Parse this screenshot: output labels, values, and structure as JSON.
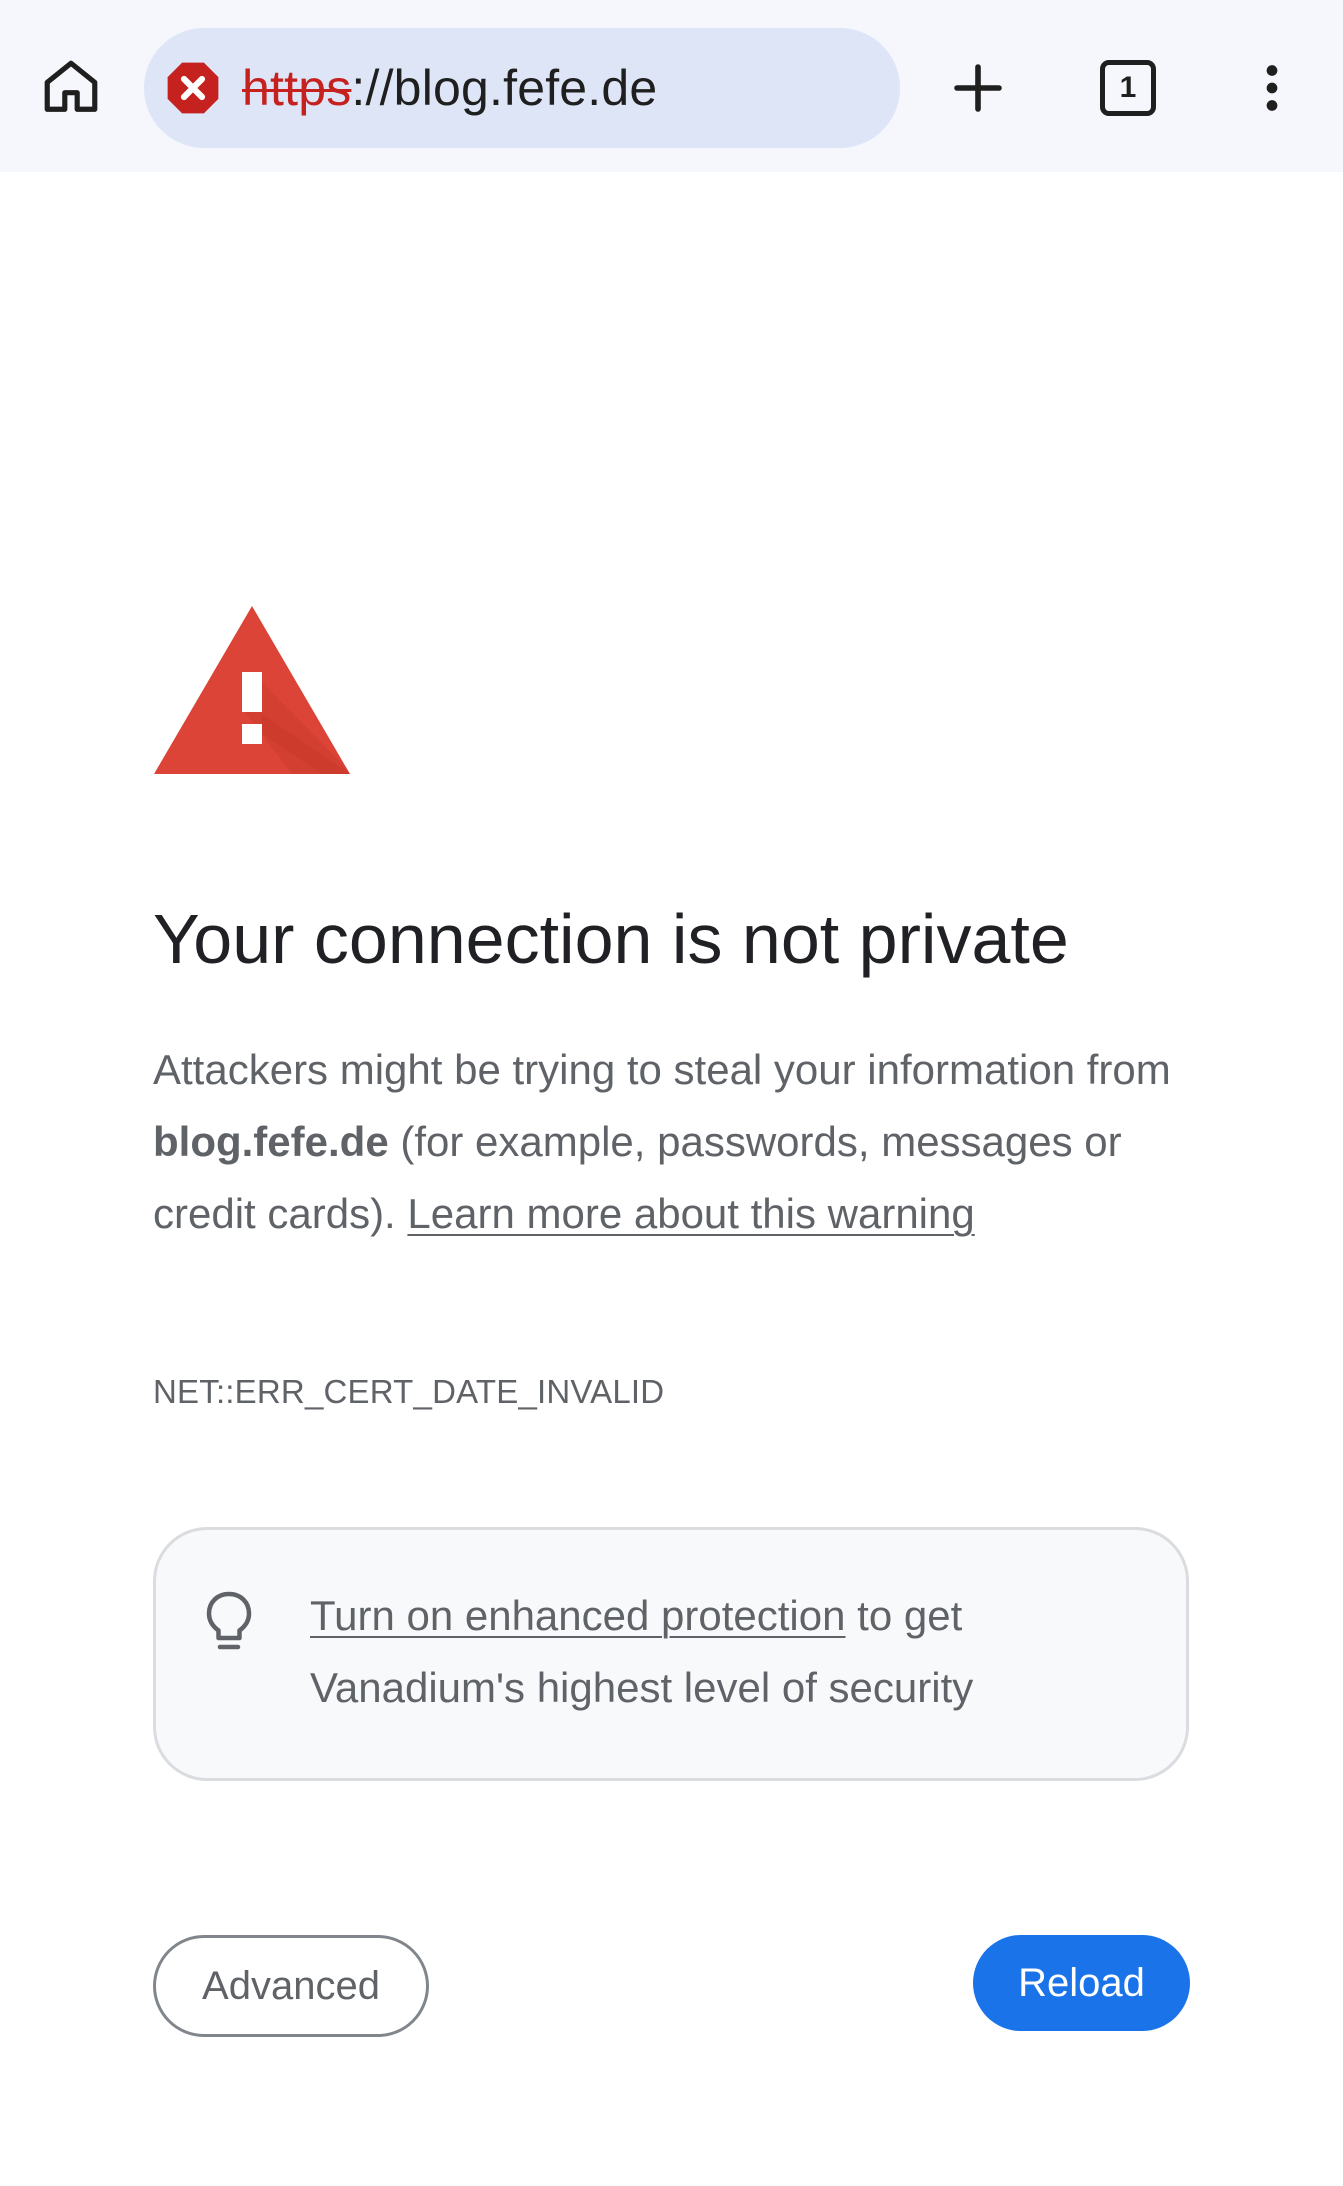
{
  "toolbar": {
    "url_scheme": "https",
    "url_rest": "://blog.fefe.de",
    "tab_count": "1",
    "home_icon": "home-icon",
    "security_icon": "not-secure-icon",
    "new_tab_icon": "plus-icon",
    "menu_icon": "more-vert-icon"
  },
  "interstitial": {
    "heading": "Your connection is not private",
    "body_prefix": "Attackers might be trying to steal your information from ",
    "body_domain": "blog.fefe.de",
    "body_suffix": " (for example, passwords, messages or credit cards). ",
    "learn_more": "Learn more about this warning",
    "error_code": "NET::ERR_CERT_DATE_INVALID",
    "enhanced_link": "Turn on enhanced protection",
    "enhanced_suffix": " to get Vanadium's highest level of security",
    "advanced_button": "Advanced",
    "reload_button": "Reload"
  },
  "colors": {
    "toolbar_bg": "#f6f7fc",
    "omnibox_bg": "#dde5f7",
    "danger_red": "#c5221f",
    "warning_red": "#db4437",
    "primary_blue": "#1a73e8",
    "secondary_text": "#5f6368"
  }
}
